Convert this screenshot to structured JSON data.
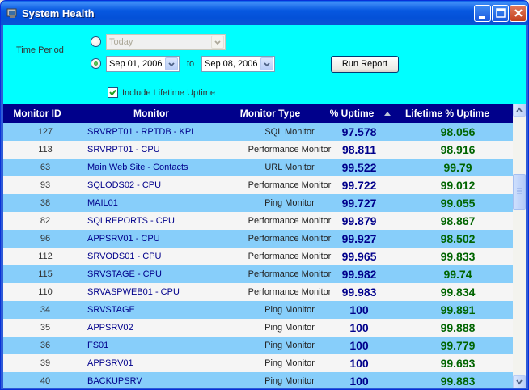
{
  "window": {
    "title": "System Health"
  },
  "filters": {
    "time_period_label": "Time Period",
    "preset_value": "Today",
    "start_date": "Sep 01, 2006",
    "to_label": "to",
    "end_date": "Sep 08, 2006",
    "run_report_label": "Run Report",
    "include_lifetime_label": "Include Lifetime Uptime",
    "include_lifetime_checked": true,
    "selected_mode": "date-range"
  },
  "grid": {
    "columns": [
      "Monitor ID",
      "Monitor",
      "Monitor Type",
      "% Uptime",
      "Lifetime % Uptime"
    ],
    "sort_column": "% Uptime",
    "sort_direction": "ascending",
    "colors": {
      "header_bg": "#00008b",
      "row_alt": "#87cefa",
      "row_plain": "#f5f5f5",
      "uptime": "#00008b",
      "lifetime": "#006400"
    },
    "rows": [
      {
        "id": "127",
        "monitor": "SRVRPT01 - RPTDB - KPI",
        "type": "SQL Monitor",
        "uptime": "97.578",
        "lifetime": "98.056"
      },
      {
        "id": "113",
        "monitor": "SRVRPT01 - CPU",
        "type": "Performance Monitor",
        "uptime": "98.811",
        "lifetime": "98.916"
      },
      {
        "id": "63",
        "monitor": "Main Web Site - Contacts",
        "type": "URL Monitor",
        "uptime": "99.522",
        "lifetime": "99.79"
      },
      {
        "id": "93",
        "monitor": "SQLODS02 - CPU",
        "type": "Performance Monitor",
        "uptime": "99.722",
        "lifetime": "99.012"
      },
      {
        "id": "38",
        "monitor": "MAIL01",
        "type": "Ping Monitor",
        "uptime": "99.727",
        "lifetime": "99.055"
      },
      {
        "id": "82",
        "monitor": "SQLREPORTS - CPU",
        "type": "Performance Monitor",
        "uptime": "99.879",
        "lifetime": "98.867"
      },
      {
        "id": "96",
        "monitor": "APPSRV01 - CPU",
        "type": "Performance Monitor",
        "uptime": "99.927",
        "lifetime": "98.502"
      },
      {
        "id": "112",
        "monitor": "SRVODS01 - CPU",
        "type": "Performance Monitor",
        "uptime": "99.965",
        "lifetime": "99.833"
      },
      {
        "id": "115",
        "monitor": "SRVSTAGE - CPU",
        "type": "Performance Monitor",
        "uptime": "99.982",
        "lifetime": "99.74"
      },
      {
        "id": "110",
        "monitor": "SRVASPWEB01 - CPU",
        "type": "Performance Monitor",
        "uptime": "99.983",
        "lifetime": "99.834"
      },
      {
        "id": "34",
        "monitor": "SRVSTAGE",
        "type": "Ping Monitor",
        "uptime": "100",
        "lifetime": "99.891"
      },
      {
        "id": "35",
        "monitor": "APPSRV02",
        "type": "Ping Monitor",
        "uptime": "100",
        "lifetime": "99.888"
      },
      {
        "id": "36",
        "monitor": "FS01",
        "type": "Ping Monitor",
        "uptime": "100",
        "lifetime": "99.779"
      },
      {
        "id": "39",
        "monitor": "APPSRV01",
        "type": "Ping Monitor",
        "uptime": "100",
        "lifetime": "99.693"
      },
      {
        "id": "40",
        "monitor": "BACKUPSRV",
        "type": "Ping Monitor",
        "uptime": "100",
        "lifetime": "99.883"
      }
    ]
  }
}
